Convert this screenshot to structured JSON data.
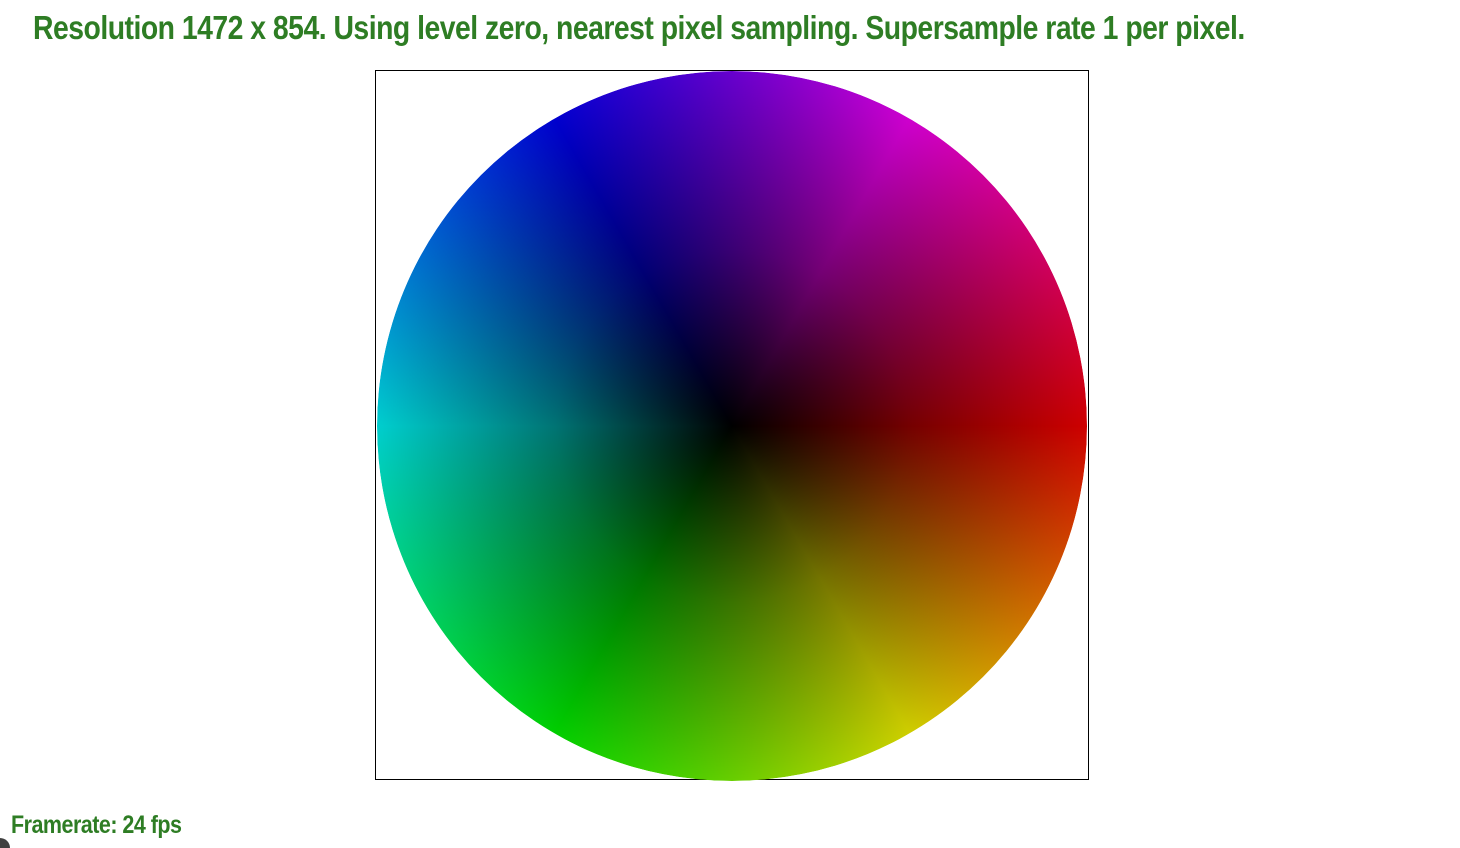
{
  "header": {
    "status_line": "Resolution 1472 x 854. Using level zero, nearest pixel sampling. Supersample rate 1 per pixel."
  },
  "footer": {
    "framerate_text": "Framerate: 24 fps"
  },
  "colors": {
    "status_text": "#2e7d24",
    "background": "#ffffff",
    "frame_border": "#000000"
  },
  "wheel": {
    "description_colors": [
      "#ff0000",
      "#ffff00",
      "#00ff00",
      "#00ffff",
      "#0000ff",
      "#ff00ff"
    ]
  }
}
